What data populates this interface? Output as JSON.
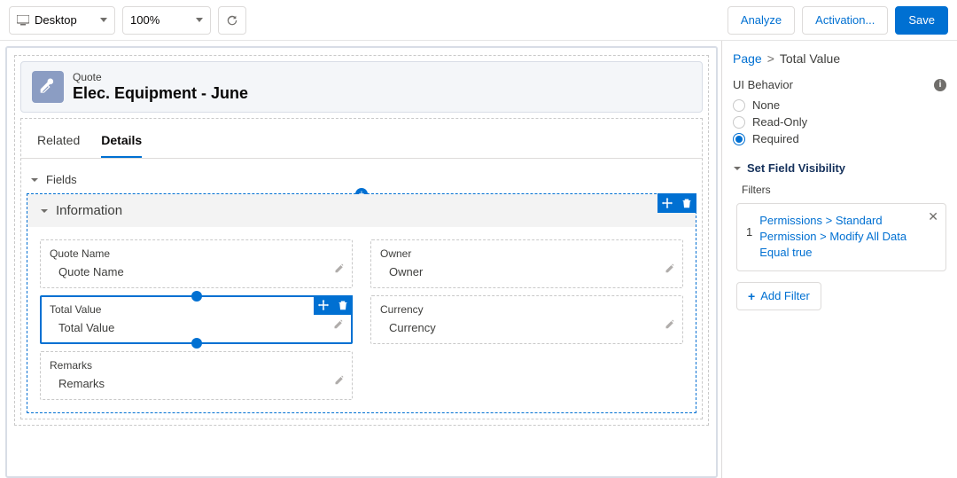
{
  "toolbar": {
    "device": "Desktop",
    "zoom": "100%",
    "analyze": "Analyze",
    "activation": "Activation...",
    "save": "Save"
  },
  "header": {
    "object": "Quote",
    "title": "Elec. Equipment - June"
  },
  "tabs": {
    "related": "Related",
    "details": "Details"
  },
  "section": {
    "fields": "Fields",
    "information": "Information"
  },
  "fields": {
    "quoteName": {
      "label": "Quote Name",
      "value": "Quote Name"
    },
    "totalValue": {
      "label": "Total Value",
      "value": "Total Value"
    },
    "remarks": {
      "label": "Remarks",
      "value": "Remarks"
    },
    "owner": {
      "label": "Owner",
      "value": "Owner"
    },
    "currency": {
      "label": "Currency",
      "value": "Currency"
    }
  },
  "right": {
    "bc_page": "Page",
    "bc_current": "Total Value",
    "ui_behavior": "UI Behavior",
    "opt_none": "None",
    "opt_readonly": "Read-Only",
    "opt_required": "Required",
    "visibility": "Set Field Visibility",
    "filters_label": "Filters",
    "filter1_num": "1",
    "filter1_text": "Permissions > Standard Permission > Modify All Data Equal true",
    "add_filter": "Add Filter"
  }
}
